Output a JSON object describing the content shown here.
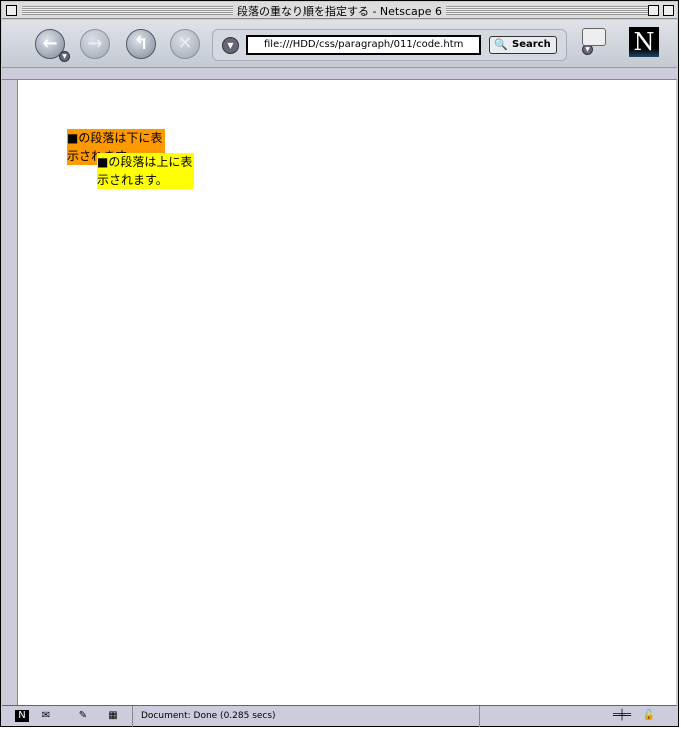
{
  "window": {
    "title": "段落の重なり順を指定する - Netscape 6"
  },
  "toolbar": {
    "url": "file:///HDD/css/paragraph/011/code.htm",
    "search_label": "Search",
    "logo": "N"
  },
  "content": {
    "paragraph_lower": "■の段落は下に表示されます。",
    "paragraph_upper": "■の段落は上に表示されます。"
  },
  "colors": {
    "lower_bg": "#ff9900",
    "upper_bg": "#ffff00"
  },
  "status": {
    "text": "Document: Done (0.285 secs)"
  }
}
